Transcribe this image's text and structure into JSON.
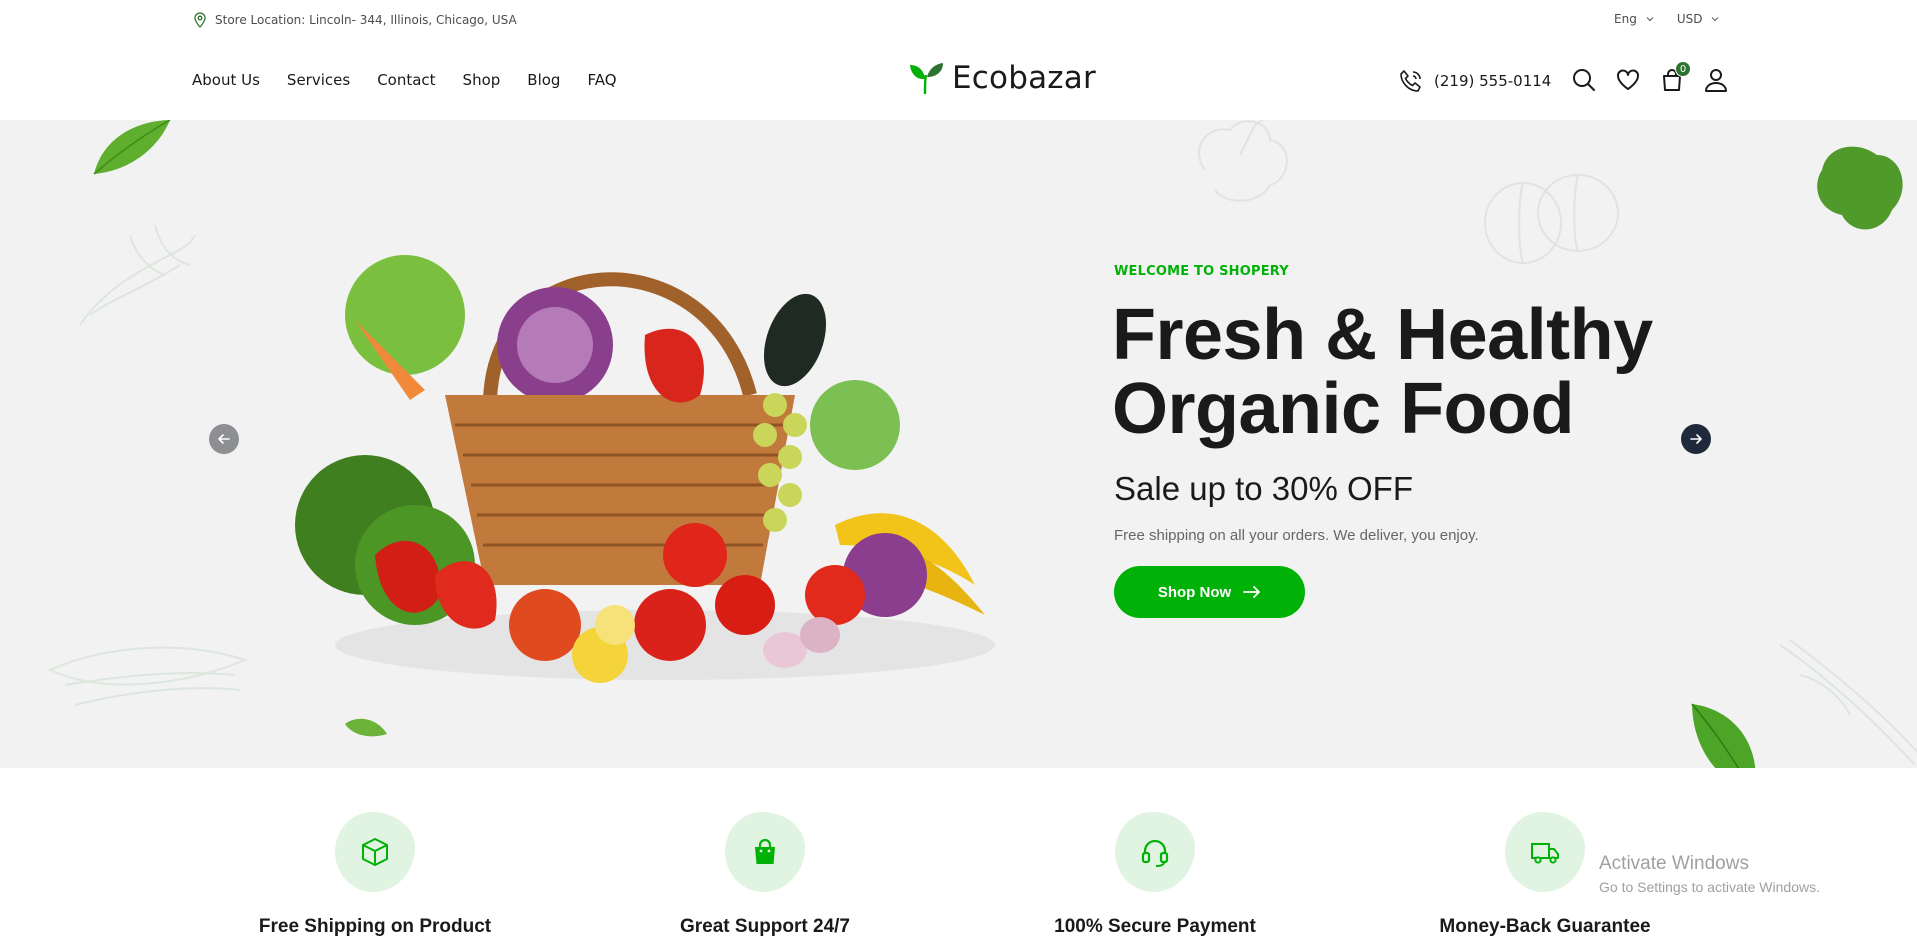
{
  "topbar": {
    "location": "Store Location: Lincoln- 344, Illinois, Chicago, USA",
    "language": "Eng",
    "currency": "USD"
  },
  "nav": {
    "menu": [
      "About Us",
      "Services",
      "Contact",
      "Shop",
      "Blog",
      "FAQ"
    ],
    "logo_text": "Ecobazar",
    "phone": "(219) 555-0114",
    "cart_count": "0"
  },
  "hero": {
    "eyebrow": "WELCOME TO SHOPERY",
    "headline_line1": "Fresh & Healthy",
    "headline_line2": "Organic Food",
    "sale": "Sale up to 30% OFF",
    "subtext": "Free shipping on all your orders. We deliver, you enjoy.",
    "cta": "Shop Now"
  },
  "features": [
    {
      "title": "Free Shipping on Product",
      "icon": "box-icon"
    },
    {
      "title": "Great Support 24/7",
      "icon": "shopping-bag-icon"
    },
    {
      "title": "100% Secure Payment",
      "icon": "headphones-icon"
    },
    {
      "title": "Money-Back Guarantee",
      "icon": "truck-icon"
    }
  ],
  "watermark": {
    "line1": "Activate Windows",
    "line2": "Go to Settings to activate Windows."
  },
  "colors": {
    "brand_green": "#00b207",
    "dark_green": "#2c742f",
    "hero_bg": "#f2f2f2",
    "feature_bg": "#e1f4e1",
    "text_dark": "#1a1a1a"
  }
}
